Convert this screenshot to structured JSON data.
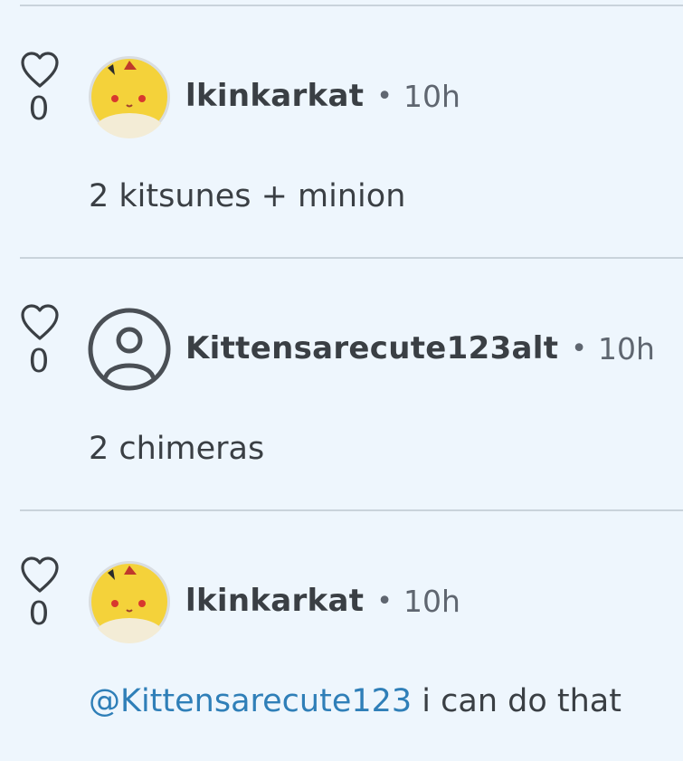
{
  "comments": [
    {
      "likes": "0",
      "username": "lkinkarkat",
      "separator": "•",
      "time": "10h",
      "avatar": "pikachu-avatar",
      "mention": "",
      "text": "2 kitsunes + minion"
    },
    {
      "likes": "0",
      "username": "Kittensarecute123alt",
      "separator": "•",
      "time": "10h",
      "avatar": "default-user-icon",
      "mention": "",
      "text": "2 chimeras"
    },
    {
      "likes": "0",
      "username": "lkinkarkat",
      "separator": "•",
      "time": "10h",
      "avatar": "pikachu-avatar",
      "mention": "@Kittensarecute123",
      "text": " i can do that"
    }
  ],
  "colors": {
    "background": "#eef6fd",
    "text": "#3a3f44",
    "muted": "#5f6670",
    "mention": "#2f7fb8",
    "divider": "#c9d3db"
  }
}
